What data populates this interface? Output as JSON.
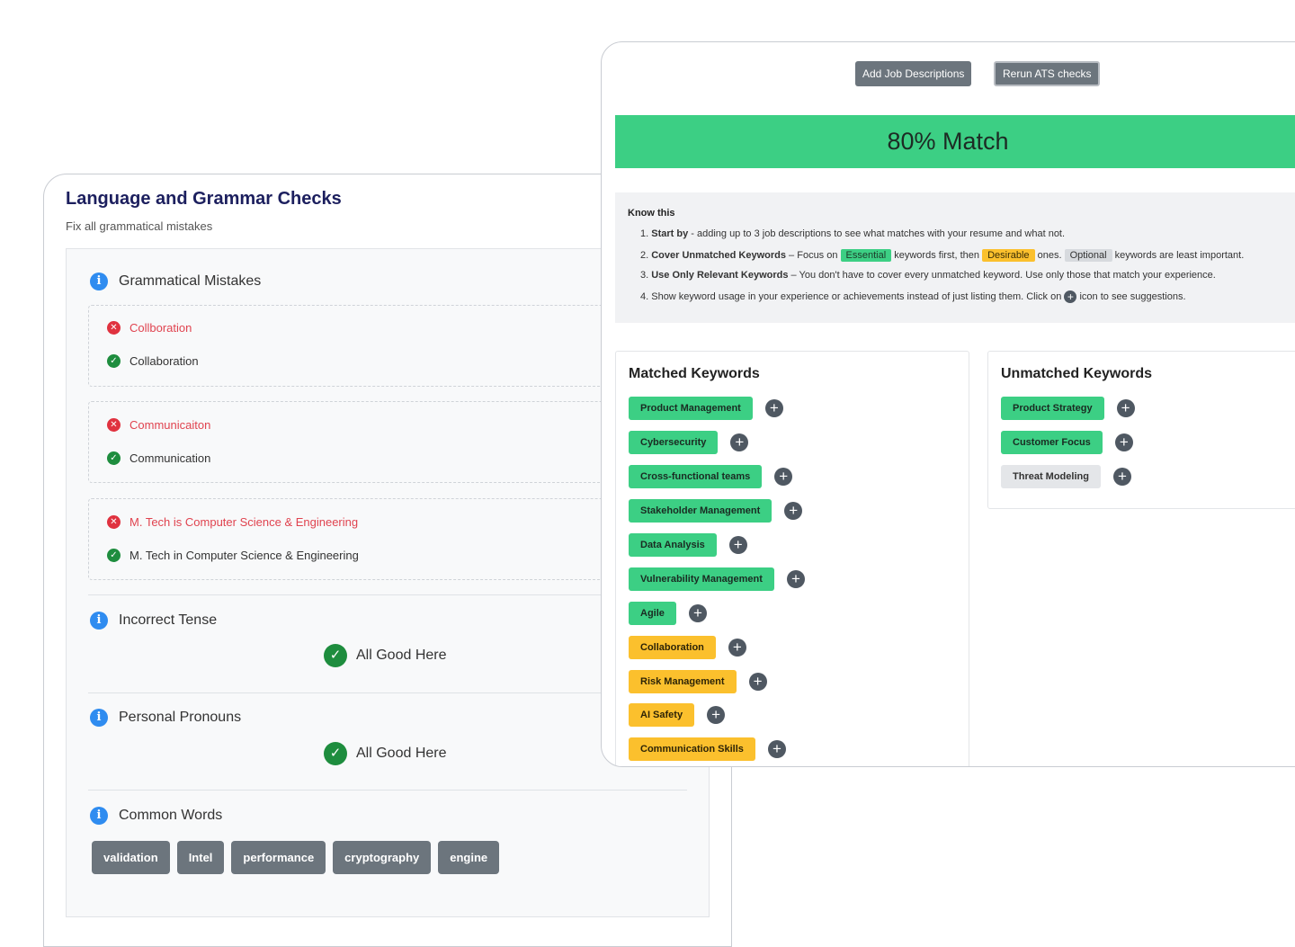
{
  "grammar": {
    "title": "Language and Grammar Checks",
    "subtitle": "Fix all grammatical mistakes",
    "sections": {
      "mistakes": {
        "label": "Grammatical Mistakes"
      },
      "tense": {
        "label": "Incorrect Tense",
        "status": "All Good Here"
      },
      "pronouns": {
        "label": "Personal Pronouns",
        "status": "All Good Here"
      },
      "common": {
        "label": "Common Words"
      }
    },
    "mistakes": [
      {
        "wrong": "Collboration",
        "right": "Collaboration"
      },
      {
        "wrong": "Communicaiton",
        "right": "Communication"
      },
      {
        "wrong": "M. Tech is Computer Science & Engineering",
        "right": "M. Tech in Computer Science & Engineering"
      }
    ],
    "common_words": [
      "validation",
      "Intel",
      "performance",
      "cryptography",
      "engine"
    ]
  },
  "ats": {
    "add_button": "Add Job Descriptions",
    "rerun_button": "Rerun ATS checks",
    "match": "80% Match",
    "know": {
      "title": "Know this",
      "item1_bold": "Start by",
      "item1_rest": " - adding up to 3 job descriptions to see what matches with your resume and what not.",
      "item2_bold": "Cover Unmatched Keywords",
      "item2_a": " – Focus on ",
      "essential": "Essential",
      "item2_b": " keywords first, then ",
      "desirable": "Desirable",
      "item2_c": " ones. ",
      "optional": "Optional",
      "item2_d": " keywords are least important.",
      "item3_bold": "Use Only Relevant Keywords",
      "item3_rest": " – You don't have to cover every unmatched keyword. Use only those that match your experience.",
      "item4_a": "Show keyword usage in your experience or achievements instead of just listing them. Click on ",
      "item4_b": " icon to see suggestions."
    },
    "matched": {
      "title": "Matched Keywords",
      "items": [
        {
          "label": "Product Management",
          "priority": "essential"
        },
        {
          "label": "Cybersecurity",
          "priority": "essential"
        },
        {
          "label": "Cross-functional teams",
          "priority": "essential"
        },
        {
          "label": "Stakeholder Management",
          "priority": "essential"
        },
        {
          "label": "Data Analysis",
          "priority": "essential"
        },
        {
          "label": "Vulnerability Management",
          "priority": "essential"
        },
        {
          "label": "Agile",
          "priority": "essential"
        },
        {
          "label": "Collaboration",
          "priority": "desirable"
        },
        {
          "label": "Risk Management",
          "priority": "desirable"
        },
        {
          "label": "AI Safety",
          "priority": "desirable"
        },
        {
          "label": "Communication Skills",
          "priority": "desirable"
        }
      ]
    },
    "unmatched": {
      "title": "Unmatched Keywords",
      "items": [
        {
          "label": "Product Strategy",
          "priority": "essential"
        },
        {
          "label": "Customer Focus",
          "priority": "essential"
        },
        {
          "label": "Threat Modeling",
          "priority": "optional"
        }
      ]
    }
  },
  "colors": {
    "essential": "#3ccf84",
    "desirable": "#fbc02d",
    "optional": "#e4e6e9",
    "title_navy": "#1c1f5e",
    "error_red": "#e0434f",
    "ok_green": "#1e8d3e",
    "info_blue": "#2f8cf0"
  },
  "icons": {
    "info": "info-icon",
    "error": "x-circle-icon",
    "ok": "check-circle-icon",
    "add": "plus-circle-icon"
  }
}
